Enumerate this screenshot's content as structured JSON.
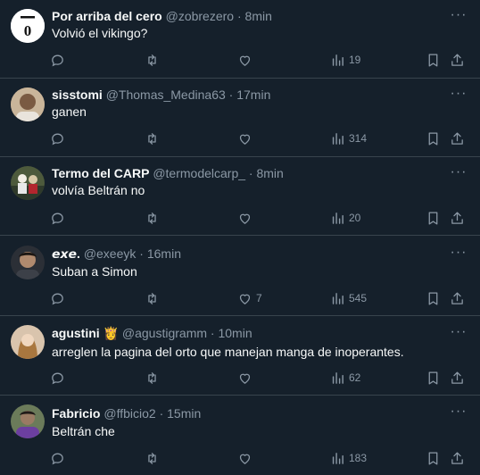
{
  "tweets": [
    {
      "name": "Por arriba del cero",
      "handle": "@zobrezero",
      "dot": "·",
      "time": "8min",
      "text": "Volvió el vikingo?",
      "likes": "",
      "views": "19",
      "avatar_initial": "0"
    },
    {
      "name": "sisstomi",
      "handle": "@Thomas_Medina63",
      "dot": "·",
      "time": "17min",
      "text": "ganen",
      "likes": "",
      "views": "314"
    },
    {
      "name": "Termo del CARP",
      "handle": "@termodelcarp_",
      "dot": "·",
      "time": "8min",
      "text": "volvía Beltrán no",
      "likes": "",
      "views": "20"
    },
    {
      "name": "𝙚𝙭𝙚.",
      "handle": "@exeeyk",
      "dot": "·",
      "time": "16min",
      "text": "Suban a Simon",
      "likes": "7",
      "views": "545"
    },
    {
      "name": "agustini 👸",
      "handle": "@agustigramm",
      "dot": "·",
      "time": "10min",
      "text": "arreglen la pagina del orto que manejan manga de inoperantes.",
      "likes": "",
      "views": "62"
    },
    {
      "name": "Fabricio",
      "handle": "@ffbicio2",
      "dot": "·",
      "time": "15min",
      "text": "Beltrán che",
      "likes": "",
      "views": "183"
    }
  ],
  "more_glyph": "···",
  "colors": {
    "background": "#15202b",
    "divider": "#38444d",
    "muted": "#8b98a5",
    "text": "#f7f9f9"
  },
  "icons": [
    "reply-icon",
    "retweet-icon",
    "like-icon",
    "views-icon",
    "bookmark-icon",
    "share-icon",
    "more-icon"
  ]
}
